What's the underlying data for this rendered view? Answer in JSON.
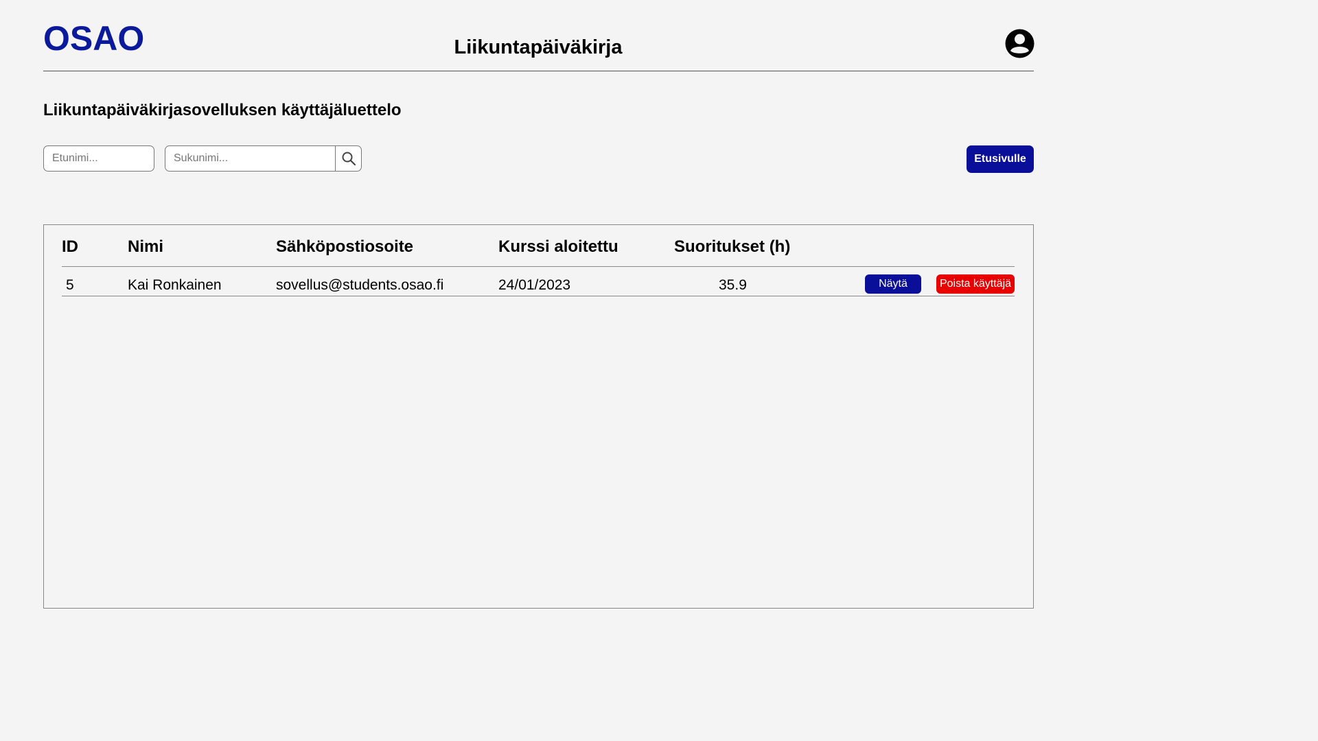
{
  "header": {
    "logo": "OSAO",
    "title": "Liikuntapäiväkirja",
    "user_icon": "account-circle-icon"
  },
  "page": {
    "section_title": "Liikuntapäiväkirjasovelluksen käyttäjäluettelo"
  },
  "filters": {
    "first_name_placeholder": "Etunimi...",
    "last_name_placeholder": "Sukunimi...",
    "search_icon": "search-icon",
    "home_button": "Etusivulle"
  },
  "table": {
    "headers": [
      "ID",
      "Nimi",
      "Sähköpostiosoite",
      "Kurssi aloitettu",
      "Suoritukset (h)"
    ],
    "rows": [
      {
        "id": "5",
        "name": "Kai Ronkainen",
        "email": "sovellus@students.osao.fi",
        "course_started": "24/01/2023",
        "hours": "35.9",
        "show_label": "Näytä",
        "delete_label": "Poista käyttäjä"
      }
    ]
  },
  "colors": {
    "brand": "#0a1a9a",
    "primary_button": "#0a0f9a",
    "danger_button": "#e80000",
    "background": "#f4f4f4"
  }
}
